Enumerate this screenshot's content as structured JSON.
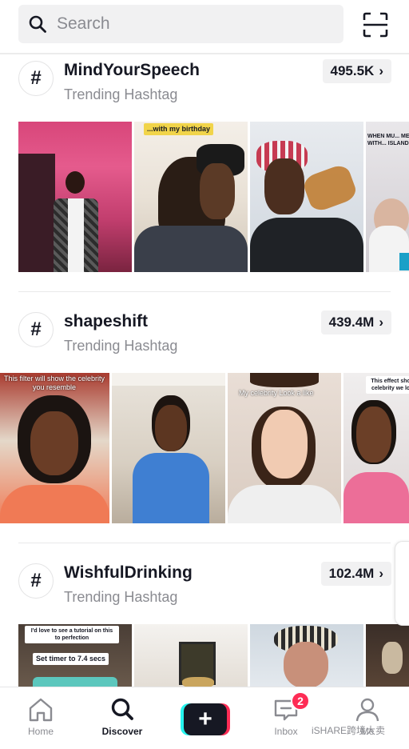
{
  "search": {
    "placeholder": "Search"
  },
  "icons": {
    "search": "search-icon",
    "scan": "scan-icon",
    "hashtag": "hashtag-icon",
    "chevron": "chevron-right-icon",
    "home": "home-icon",
    "discover": "discover-search-icon",
    "create": "plus-icon",
    "inbox": "inbox-message-icon",
    "me": "profile-icon"
  },
  "sections": [
    {
      "symbol": "#",
      "title": "MindYourSpeech",
      "subtitle": "Trending Hashtag",
      "count": "495.5K",
      "chevron": "›",
      "thumbs": [
        {
          "caption": ""
        },
        {
          "caption": "...with my birthday"
        },
        {
          "caption": ""
        },
        {
          "caption": "WHEN MU... MEET WITH... ISLAND"
        }
      ]
    },
    {
      "symbol": "#",
      "title": "shapeshift",
      "subtitle": "Trending Hashtag",
      "count": "439.4M",
      "chevron": "›",
      "thumbs": [
        {
          "caption": "This filter will show the celebrity you resemble"
        },
        {
          "caption": ""
        },
        {
          "caption": "My celebrity Look a like"
        },
        {
          "caption": "This effect sho... celebrity we lo..."
        }
      ]
    },
    {
      "symbol": "#",
      "title": "WishfulDrinking",
      "subtitle": "Trending Hashtag",
      "count": "102.4M",
      "chevron": "›",
      "thumbs": [
        {
          "caption": "I'd love to see a tutorial on this to perfection"
        },
        {
          "caption": "Set timer to 7.4 secs"
        },
        {
          "caption": ""
        },
        {
          "caption": ""
        }
      ]
    }
  ],
  "nav": {
    "home": "Home",
    "discover": "Discover",
    "create": "+",
    "inbox": "Inbox",
    "inbox_badge": "2",
    "me": "Me"
  },
  "watermark": "iSHARE跨境大卖",
  "colors": {
    "accent_red": "#fe2c55",
    "accent_cyan": "#25f4ee",
    "text": "#161823",
    "muted": "#8a8b91"
  }
}
